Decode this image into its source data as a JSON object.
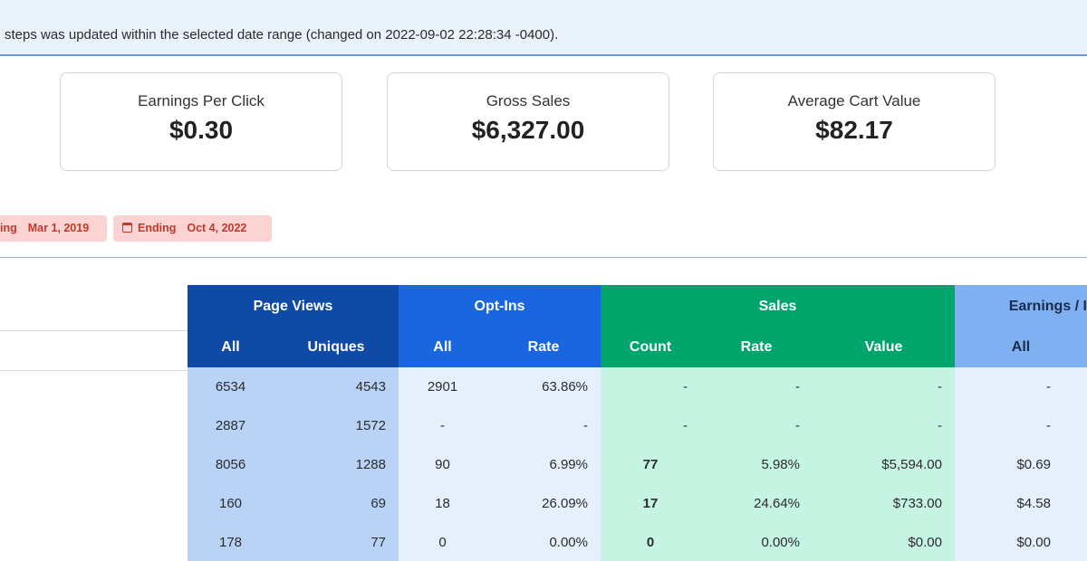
{
  "notice": "steps was updated within the selected date range (changed on 2022-09-02 22:28:34 -0400).",
  "stats": [
    {
      "label": "Earnings Per Click",
      "value": "$0.30"
    },
    {
      "label": "Gross Sales",
      "value": "$6,327.00"
    },
    {
      "label": "Average Cart Value",
      "value": "$82.17"
    }
  ],
  "date_filters": {
    "start": {
      "label": "ing",
      "value": "Mar 1, 2019"
    },
    "end": {
      "label": "Ending",
      "value": "Oct 4, 2022",
      "icon": "calendar-icon"
    }
  },
  "table": {
    "groups": [
      "Page Views",
      "Opt-Ins",
      "Sales",
      "Earnings / I"
    ],
    "subheaders": [
      "All",
      "Uniques",
      "All",
      "Rate",
      "Count",
      "Rate",
      "Value",
      "All"
    ],
    "rows": [
      [
        "6534",
        "4543",
        "2901",
        "63.86%",
        "-",
        "-",
        "-",
        "-"
      ],
      [
        "2887",
        "1572",
        "-",
        "-",
        "-",
        "-",
        "-",
        "-"
      ],
      [
        "8056",
        "1288",
        "90",
        "6.99%",
        "77",
        "5.98%",
        "$5,594.00",
        "$0.69"
      ],
      [
        "160",
        "69",
        "18",
        "26.09%",
        "17",
        "24.64%",
        "$733.00",
        "$4.58"
      ],
      [
        "178",
        "77",
        "0",
        "0.00%",
        "0",
        "0.00%",
        "$0.00",
        "$0.00"
      ]
    ]
  },
  "colors": {
    "page_views": "#0f4aa6",
    "opt_ins": "#1a66de",
    "sales": "#00a56b",
    "earnings": "#7fb0f2",
    "date_tag": "#fbd3d3"
  }
}
